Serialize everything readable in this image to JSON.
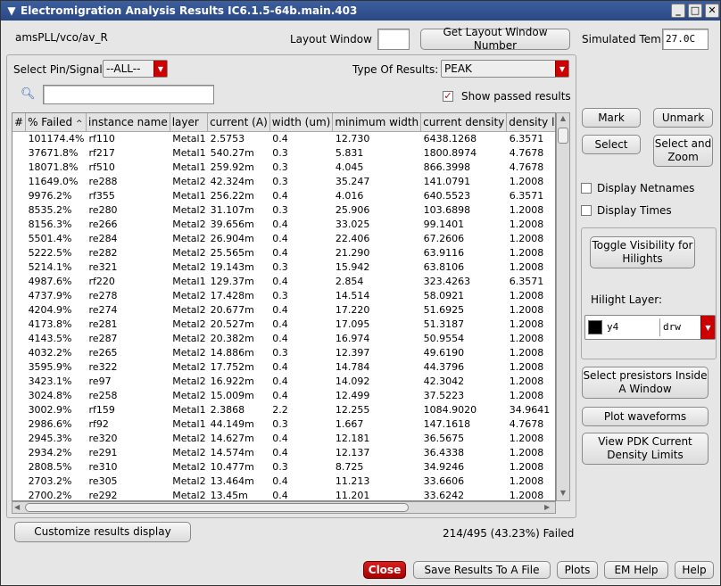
{
  "window": {
    "title": "Electromigration Analysis Results IC6.1.5-64b.main.403",
    "menu_icon": "chevron-down-icon",
    "min_icon": "minimize-icon",
    "max_icon": "maximize-icon",
    "close_icon": "close-icon"
  },
  "header": {
    "cell_path": "amsPLL/vco/av_R",
    "layout_window_label": "Layout Window",
    "layout_window_value": "",
    "get_layout_button": "Get Layout Window Number",
    "sim_temp_label": "Simulated Temp",
    "sim_temp_value": "27.0C"
  },
  "filters": {
    "pin_label": "Select Pin/Signal:",
    "pin_value": "--ALL--",
    "type_label": "Type Of Results:",
    "type_value": "PEAK",
    "search_placeholder": "",
    "search_value": "",
    "show_passed_label": "Show passed results",
    "show_passed_checked": true
  },
  "table": {
    "columns": [
      "#",
      "% Failed",
      "instance name",
      "layer",
      "current (A)",
      "width (um)",
      "minimum width",
      "current density",
      "density l"
    ],
    "sort_indicator": "^",
    "rows": [
      [
        "",
        "101174.4%",
        "rf110",
        "Metal1",
        "2.5753",
        "0.4",
        "12.730",
        "6438.1268",
        "6.3571"
      ],
      [
        "",
        "37671.8%",
        "rf217",
        "Metal1",
        "540.27m",
        "0.3",
        "5.831",
        "1800.8974",
        "4.7678"
      ],
      [
        "",
        "18071.8%",
        "rf510",
        "Metal1",
        "259.92m",
        "0.3",
        "4.045",
        "866.3998",
        "4.7678"
      ],
      [
        "",
        "11649.0%",
        "re288",
        "Metal2",
        "42.324m",
        "0.3",
        "35.247",
        "141.0791",
        "1.2008"
      ],
      [
        "",
        "9976.2%",
        "rf355",
        "Metal1",
        "256.22m",
        "0.4",
        "4.016",
        "640.5523",
        "6.3571"
      ],
      [
        "",
        "8535.2%",
        "re280",
        "Metal2",
        "31.107m",
        "0.3",
        "25.906",
        "103.6898",
        "1.2008"
      ],
      [
        "",
        "8156.3%",
        "re266",
        "Metal2",
        "39.656m",
        "0.4",
        "33.025",
        "99.1401",
        "1.2008"
      ],
      [
        "",
        "5501.4%",
        "re284",
        "Metal2",
        "26.904m",
        "0.4",
        "22.406",
        "67.2606",
        "1.2008"
      ],
      [
        "",
        "5222.5%",
        "re282",
        "Metal2",
        "25.565m",
        "0.4",
        "21.290",
        "63.9116",
        "1.2008"
      ],
      [
        "",
        "5214.1%",
        "re321",
        "Metal2",
        "19.143m",
        "0.3",
        "15.942",
        "63.8106",
        "1.2008"
      ],
      [
        "",
        "4987.6%",
        "rf220",
        "Metal1",
        "129.37m",
        "0.4",
        "2.854",
        "323.4263",
        "6.3571"
      ],
      [
        "",
        "4737.9%",
        "re278",
        "Metal2",
        "17.428m",
        "0.3",
        "14.514",
        "58.0921",
        "1.2008"
      ],
      [
        "",
        "4204.9%",
        "re274",
        "Metal2",
        "20.677m",
        "0.4",
        "17.220",
        "51.6925",
        "1.2008"
      ],
      [
        "",
        "4173.8%",
        "re281",
        "Metal2",
        "20.527m",
        "0.4",
        "17.095",
        "51.3187",
        "1.2008"
      ],
      [
        "",
        "4143.5%",
        "re287",
        "Metal2",
        "20.382m",
        "0.4",
        "16.974",
        "50.9554",
        "1.2008"
      ],
      [
        "",
        "4032.2%",
        "re265",
        "Metal2",
        "14.886m",
        "0.3",
        "12.397",
        "49.6190",
        "1.2008"
      ],
      [
        "",
        "3595.9%",
        "re322",
        "Metal2",
        "17.752m",
        "0.4",
        "14.784",
        "44.3796",
        "1.2008"
      ],
      [
        "",
        "3423.1%",
        "re97",
        "Metal2",
        "16.922m",
        "0.4",
        "14.092",
        "42.3042",
        "1.2008"
      ],
      [
        "",
        "3024.8%",
        "re258",
        "Metal2",
        "15.009m",
        "0.4",
        "12.499",
        "37.5223",
        "1.2008"
      ],
      [
        "",
        "3002.9%",
        "rf159",
        "Metal1",
        "2.3868",
        "2.2",
        "12.255",
        "1084.9020",
        "34.9641"
      ],
      [
        "",
        "2986.6%",
        "rf92",
        "Metal1",
        "44.149m",
        "0.3",
        "1.667",
        "147.1618",
        "4.7678"
      ],
      [
        "",
        "2945.3%",
        "re320",
        "Metal2",
        "14.627m",
        "0.4",
        "12.181",
        "36.5675",
        "1.2008"
      ],
      [
        "",
        "2934.2%",
        "re291",
        "Metal2",
        "14.574m",
        "0.4",
        "12.137",
        "36.4338",
        "1.2008"
      ],
      [
        "",
        "2808.5%",
        "re310",
        "Metal2",
        "10.477m",
        "0.3",
        "8.725",
        "34.9246",
        "1.2008"
      ],
      [
        "",
        "2703.2%",
        "re305",
        "Metal2",
        "13.464m",
        "0.4",
        "11.213",
        "33.6606",
        "1.2008"
      ],
      [
        "",
        "2700.2%",
        "re292",
        "Metal2",
        "13.45m",
        "0.4",
        "11.201",
        "33.6242",
        "1.2008"
      ]
    ]
  },
  "right_panel": {
    "mark": "Mark",
    "unmark": "Unmark",
    "select": "Select",
    "select_zoom": "Select and Zoom",
    "display_netnames": "Display Netnames",
    "display_times": "Display Times",
    "toggle_visibility": "Toggle Visibility for Hilights",
    "hilight_layer_label": "Hilight Layer:",
    "hilight_layer_value": "y4",
    "hilight_purpose_value": "drw",
    "hilight_color": "#000000",
    "select_presistors": "Select presistors Inside A Window",
    "plot_waveforms": "Plot waveforms",
    "view_pdk": "View PDK Current Density Limits"
  },
  "footer": {
    "customize": "Customize results display",
    "status": "214/495 (43.23%) Failed",
    "close": "Close",
    "save": "Save Results To A File",
    "plots": "Plots",
    "em_help": "EM Help",
    "help": "Help"
  },
  "colors": {
    "title_bar": "#2e4c88",
    "accent_red": "#cc0000",
    "close_button": "#c00000"
  }
}
